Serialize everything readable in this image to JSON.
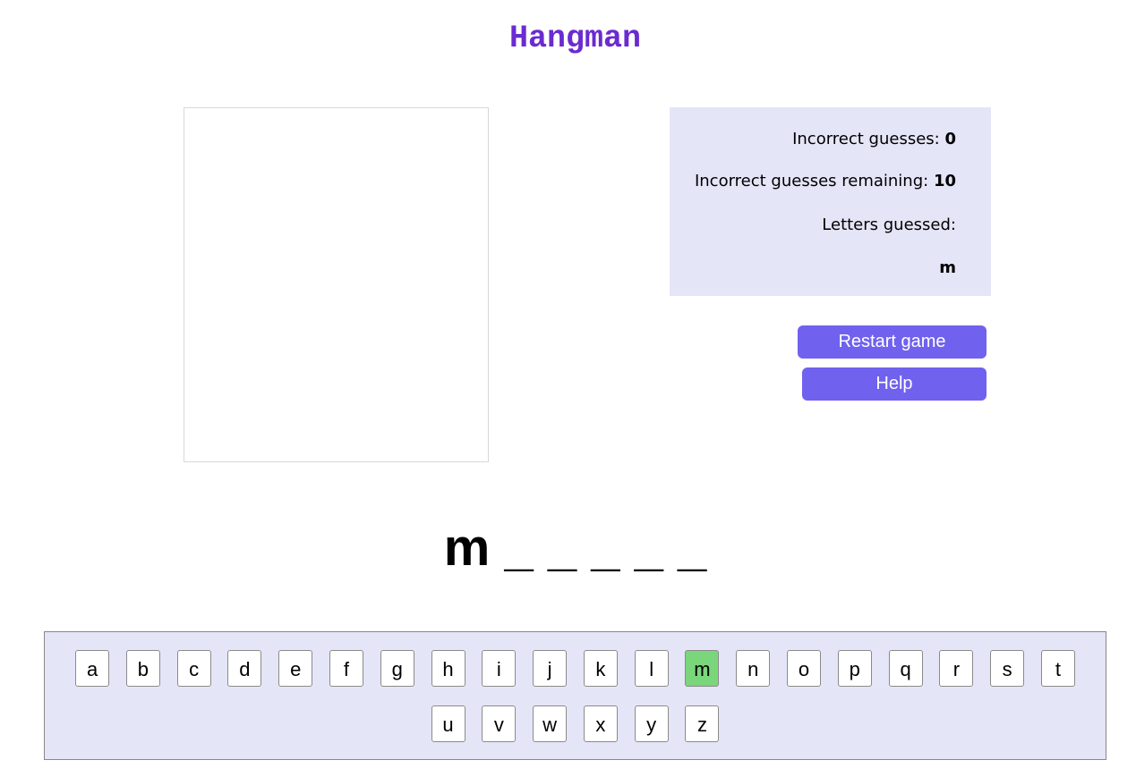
{
  "title": "Hangman",
  "stats": {
    "incorrect_label": "Incorrect guesses: ",
    "incorrect_value": "0",
    "remaining_label": "Incorrect guesses remaining: ",
    "remaining_value": "10",
    "letters_label": "Letters guessed:",
    "letters_list": "m"
  },
  "buttons": {
    "restart": "Restart game",
    "help": "Help"
  },
  "word_display": "m _ _ _ _ _",
  "keyboard": {
    "row1": [
      "a",
      "b",
      "c",
      "d",
      "e",
      "f",
      "g",
      "h",
      "i",
      "j",
      "k",
      "l",
      "m",
      "n",
      "o",
      "p",
      "q",
      "r",
      "s",
      "t"
    ],
    "row2": [
      "u",
      "v",
      "w",
      "x",
      "y",
      "z"
    ],
    "guessed": [
      "m"
    ]
  },
  "colors": {
    "title": "#6a2bd0",
    "panel_bg": "#e5e5f8",
    "button_bg": "#7061ee",
    "guessed_key_bg": "#7ad67b"
  }
}
